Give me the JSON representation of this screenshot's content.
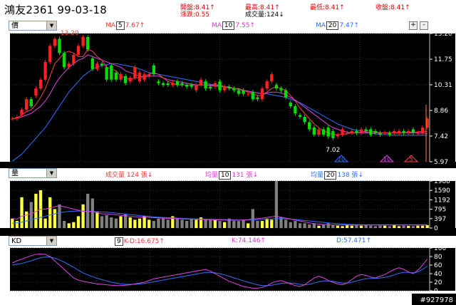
{
  "header": {
    "title": "鴻友2361 99-03-18",
    "open": "開盤:8.41↑",
    "change": "漲跌:0.55",
    "high": "最高:8.41↑",
    "volume": "成交量:124↓",
    "low": "最低:8.41↑",
    "close": "收盤:8.41↑"
  },
  "price_panel": {
    "selector": "價",
    "ma1": {
      "prefix": "MA",
      "period": "5",
      "value": "7.67↑",
      "color": "#e00000"
    },
    "ma2": {
      "prefix": "MA",
      "period": "10",
      "value": "7.55↑",
      "color": "#c000c0"
    },
    "ma3": {
      "prefix": "MA",
      "period": "20",
      "value": "7.47↑",
      "color": "#0060ff"
    },
    "zoom_in": "+",
    "zoom_out": "-",
    "high_label": "13.20",
    "low_label": "7.02"
  },
  "volume_panel": {
    "selector": "量",
    "vol_label": "成交量 124 張↓",
    "avg1": {
      "prefix": "均量",
      "period": "10",
      "value": "131 張↓"
    },
    "avg2": {
      "prefix": "均量",
      "period": "20",
      "value": "138 張↓"
    }
  },
  "kd_panel": {
    "selector": "KD",
    "period": "9",
    "kd_label": "K-D:16.675↑",
    "k_label": "K:74.146↑",
    "d_label": "D:57.471↑"
  },
  "markers": [
    "20",
    "10",
    "5"
  ],
  "watermark": "#927978",
  "colors": {
    "up": "#ff2020",
    "down": "#00e000",
    "ma5": "#ff4040",
    "ma10": "#e040e0",
    "ma20": "#3070ff",
    "vol": "#ffff40",
    "vol_alt": "#808080",
    "k": "#e040e0",
    "d": "#3070ff",
    "axis": "#ffffff",
    "grid": "#1e3040"
  },
  "chart_data": [
    {
      "type": "candlestick",
      "yticks": [
        "13.20",
        "11.75",
        "10.31",
        "8.86",
        "7.42",
        "5.97"
      ],
      "ylim": [
        5.97,
        13.2
      ],
      "open": [
        8.4,
        8.4,
        8.6,
        8.9,
        9.5,
        9.7,
        10.1,
        10.6,
        11.6,
        12.5,
        12.9,
        12.1,
        11.3,
        11.5,
        12.0,
        12.5,
        13.0,
        11.8,
        11.2,
        11.5,
        11.3,
        11.4,
        11.0,
        10.6,
        10.8,
        10.5,
        10.7,
        10.5,
        10.6,
        10.8,
        11.4,
        10.5,
        10.4,
        10.4,
        10.3,
        10.5,
        10.4,
        10.3,
        10.3,
        10.0,
        10.3,
        10.5,
        10.2,
        10.2,
        10.5,
        10.0,
        10.2,
        10.1,
        10.0,
        10.0,
        9.8,
        9.9,
        9.6,
        9.5,
        10.1,
        10.5,
        10.3,
        10.1,
        10.0,
        9.3,
        9.1,
        8.6,
        8.5,
        8.2,
        7.9,
        7.5,
        7.8,
        7.9,
        7.7,
        7.4,
        7.5,
        7.6,
        7.6,
        7.7,
        7.6,
        7.8,
        7.8,
        7.7,
        7.6,
        7.6,
        7.6,
        7.6,
        7.6,
        7.7,
        7.6,
        7.8,
        7.6,
        7.6,
        7.9
      ],
      "close": [
        8.4,
        8.5,
        8.9,
        9.5,
        9.1,
        10.1,
        10.6,
        11.6,
        12.5,
        12.9,
        12.1,
        11.3,
        11.5,
        12.0,
        12.5,
        13.0,
        12.3,
        11.2,
        11.5,
        11.4,
        10.6,
        10.6,
        10.6,
        10.9,
        10.4,
        10.7,
        11.3,
        11.0,
        10.9,
        10.9,
        10.9,
        10.4,
        10.3,
        10.3,
        10.4,
        10.3,
        10.3,
        10.2,
        10.2,
        10.3,
        10.6,
        10.1,
        10.1,
        10.4,
        10.0,
        10.2,
        10.1,
        10.0,
        9.8,
        9.8,
        9.8,
        9.5,
        9.5,
        10.1,
        10.5,
        10.9,
        10.1,
        10.0,
        9.6,
        9.1,
        8.7,
        8.5,
        8.2,
        7.8,
        7.5,
        7.8,
        7.5,
        7.4,
        7.3,
        7.5,
        7.8,
        7.6,
        7.7,
        7.6,
        7.8,
        7.7,
        7.5,
        7.6,
        7.5,
        7.6,
        7.5,
        7.7,
        7.7,
        7.6,
        7.7,
        7.6,
        7.6,
        7.9,
        8.41
      ],
      "ma5": [
        8.4,
        8.45,
        8.6,
        8.8,
        8.9,
        9.2,
        9.6,
        10.1,
        10.8,
        11.5,
        11.8,
        12.1,
        12.2,
        12.1,
        11.9,
        11.9,
        12.3,
        12.2,
        11.9,
        11.7,
        11.3,
        11.2,
        11.1,
        10.8,
        10.7,
        10.6,
        10.7,
        10.7,
        10.8,
        10.9,
        11.0,
        10.9,
        10.7,
        10.5,
        10.4,
        10.3,
        10.3,
        10.3,
        10.3,
        10.3,
        10.3,
        10.3,
        10.3,
        10.3,
        10.3,
        10.2,
        10.2,
        10.1,
        10.1,
        10.0,
        9.9,
        9.8,
        9.7,
        9.7,
        9.9,
        10.1,
        10.2,
        10.1,
        10.0,
        9.7,
        9.4,
        9.0,
        8.7,
        8.4,
        8.1,
        7.9,
        7.7,
        7.6,
        7.5,
        7.5,
        7.5,
        7.55,
        7.6,
        7.6,
        7.65,
        7.7,
        7.7,
        7.65,
        7.6,
        7.6,
        7.6,
        7.6,
        7.6,
        7.6,
        7.65,
        7.65,
        7.65,
        7.7,
        7.67
      ],
      "ma10": [
        8.4,
        8.42,
        8.5,
        8.6,
        8.7,
        8.9,
        9.1,
        9.4,
        9.8,
        10.3,
        10.7,
        11.0,
        11.3,
        11.5,
        11.7,
        11.8,
        12.0,
        11.9,
        11.8,
        11.7,
        11.6,
        11.5,
        11.4,
        11.3,
        11.1,
        11.0,
        10.9,
        10.8,
        10.75,
        10.8,
        10.8,
        10.8,
        10.7,
        10.6,
        10.55,
        10.5,
        10.45,
        10.4,
        10.35,
        10.3,
        10.3,
        10.3,
        10.25,
        10.25,
        10.2,
        10.2,
        10.15,
        10.1,
        10.05,
        10.0,
        9.95,
        9.9,
        9.85,
        9.8,
        9.85,
        9.9,
        9.9,
        9.85,
        9.75,
        9.6,
        9.45,
        9.25,
        9.05,
        8.85,
        8.65,
        8.45,
        8.25,
        8.05,
        7.9,
        7.8,
        7.7,
        7.65,
        7.6,
        7.6,
        7.6,
        7.6,
        7.6,
        7.6,
        7.6,
        7.6,
        7.6,
        7.6,
        7.6,
        7.6,
        7.6,
        7.6,
        7.6,
        7.6,
        7.55
      ],
      "ma20": [
        6.0,
        6.2,
        6.4,
        6.7,
        7.0,
        7.3,
        7.6,
        7.9,
        8.3,
        8.7,
        9.1,
        9.5,
        9.9,
        10.2,
        10.5,
        10.8,
        11.0,
        11.2,
        11.3,
        11.4,
        11.45,
        11.5,
        11.5,
        11.45,
        11.4,
        11.35,
        11.3,
        11.2,
        11.1,
        11.0,
        10.95,
        10.9,
        10.85,
        10.8,
        10.75,
        10.7,
        10.65,
        10.6,
        10.55,
        10.5,
        10.45,
        10.4,
        10.35,
        10.3,
        10.25,
        10.2,
        10.15,
        10.1,
        10.05,
        10.0,
        9.95,
        9.9,
        9.85,
        9.8,
        9.8,
        9.75,
        9.7,
        9.65,
        9.6,
        9.5,
        9.4,
        9.3,
        9.15,
        9.0,
        8.85,
        8.7,
        8.55,
        8.4,
        8.25,
        8.1,
        8.0,
        7.9,
        7.8,
        7.75,
        7.7,
        7.65,
        7.6,
        7.55,
        7.5,
        7.5,
        7.48,
        7.47,
        7.47,
        7.47,
        7.47,
        7.47,
        7.47,
        7.47,
        7.47
      ]
    },
    {
      "type": "bar",
      "yticks": [
        "1988",
        "1590",
        "1192",
        "795",
        "397",
        "0"
      ],
      "ylim": [
        0,
        1988
      ],
      "values": [
        400,
        300,
        1300,
        700,
        1100,
        1450,
        1600,
        400,
        1300,
        800,
        1000,
        300,
        200,
        250,
        500,
        1000,
        1450,
        1250,
        700,
        500,
        550,
        450,
        400,
        500,
        600,
        450,
        350,
        400,
        500,
        350,
        300,
        400,
        400,
        350,
        500,
        400,
        350,
        300,
        400,
        350,
        450,
        350,
        350,
        350,
        300,
        250,
        400,
        300,
        300,
        350,
        200,
        800,
        300,
        300,
        400,
        350,
        1988,
        450,
        350,
        250,
        300,
        200,
        200,
        150,
        200,
        100,
        150,
        200,
        120,
        100,
        80,
        120,
        100,
        150,
        100,
        120,
        100,
        80,
        100,
        100,
        80,
        120,
        80,
        100,
        90,
        80,
        100,
        100,
        124
      ],
      "avg10": [
        400,
        380,
        500,
        550,
        600,
        700,
        800,
        800,
        850,
        900,
        950,
        900,
        850,
        800,
        750,
        700,
        700,
        700,
        650,
        600,
        600,
        580,
        560,
        540,
        520,
        500,
        480,
        470,
        460,
        450,
        440,
        430,
        420,
        410,
        400,
        400,
        390,
        380,
        380,
        370,
        360,
        360,
        350,
        350,
        340,
        340,
        330,
        330,
        330,
        340,
        350,
        380,
        400,
        420,
        450,
        480,
        500,
        460,
        420,
        380,
        340,
        300,
        260,
        220,
        190,
        170,
        150,
        140,
        130,
        130,
        130,
        130,
        130,
        130,
        130,
        130,
        130,
        130,
        130,
        130,
        130,
        130,
        131,
        131,
        131,
        131,
        131,
        131,
        131
      ],
      "avg20": [
        200,
        220,
        250,
        300,
        350,
        400,
        450,
        500,
        550,
        600,
        650,
        680,
        700,
        710,
        720,
        720,
        710,
        700,
        690,
        680,
        670,
        650,
        630,
        610,
        590,
        570,
        550,
        530,
        510,
        490,
        470,
        460,
        450,
        440,
        430,
        420,
        410,
        400,
        390,
        385,
        380,
        375,
        370,
        365,
        360,
        355,
        350,
        345,
        340,
        340,
        345,
        350,
        355,
        360,
        370,
        380,
        400,
        400,
        390,
        380,
        360,
        340,
        320,
        300,
        280,
        260,
        240,
        220,
        200,
        185,
        170,
        160,
        150,
        145,
        140,
        140,
        140,
        140,
        140,
        140,
        139,
        139,
        138,
        138,
        138,
        138,
        138,
        138,
        138
      ]
    },
    {
      "type": "line",
      "yticks": [
        "100",
        "80",
        "60",
        "40",
        "20",
        "0"
      ],
      "ylim": [
        0,
        100
      ],
      "k": [
        65,
        70,
        74,
        78,
        82,
        85,
        86,
        85,
        80,
        70,
        60,
        50,
        40,
        30,
        25,
        22,
        20,
        18,
        16,
        15,
        14,
        13,
        12,
        12,
        13,
        14,
        16,
        18,
        20,
        24,
        28,
        30,
        32,
        34,
        36,
        38,
        40,
        42,
        44,
        46,
        48,
        50,
        46,
        40,
        34,
        28,
        22,
        18,
        14,
        10,
        8,
        6,
        6,
        8,
        12,
        18,
        22,
        24,
        20,
        16,
        12,
        10,
        14,
        22,
        30,
        34,
        30,
        24,
        20,
        16,
        14,
        18,
        26,
        34,
        38,
        36,
        32,
        30,
        34,
        38,
        44,
        50,
        54,
        50,
        44,
        40,
        48,
        60,
        74.146
      ],
      "d": [
        60,
        62,
        64,
        67,
        70,
        74,
        77,
        79,
        79,
        76,
        72,
        67,
        61,
        55,
        48,
        42,
        37,
        33,
        29,
        26,
        23,
        20,
        18,
        16,
        15,
        15,
        15,
        16,
        17,
        19,
        21,
        23,
        25,
        27,
        29,
        31,
        33,
        35,
        37,
        39,
        41,
        43,
        43,
        42,
        40,
        37,
        34,
        30,
        27,
        23,
        20,
        17,
        14,
        12,
        12,
        13,
        15,
        17,
        18,
        18,
        17,
        15,
        14,
        15,
        18,
        21,
        23,
        23,
        22,
        20,
        18,
        18,
        20,
        23,
        26,
        28,
        29,
        29,
        30,
        31,
        34,
        37,
        41,
        43,
        43,
        42,
        44,
        50,
        57.471
      ]
    }
  ]
}
